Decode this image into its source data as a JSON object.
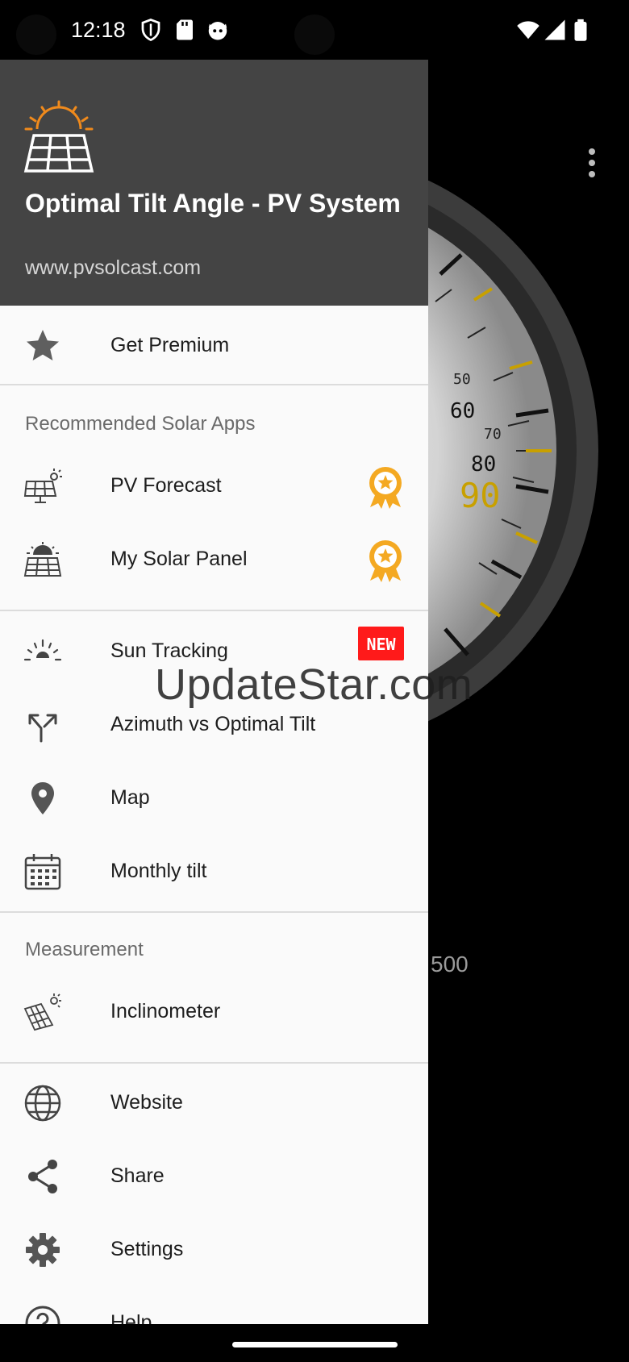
{
  "status_bar": {
    "time": "12:18",
    "left_icons": [
      "shield-icon",
      "sd-card-icon",
      "cat-icon"
    ],
    "right_icons": [
      "wifi-icon",
      "signal-icon",
      "battery-icon"
    ]
  },
  "background_app": {
    "gauge_labels": [
      "50",
      "60",
      "70",
      "80",
      "90"
    ],
    "partial_label": "500",
    "accent_color": "#c8a000"
  },
  "drawer": {
    "header": {
      "title": "Optimal Tilt Angle - PV System",
      "subtitle": "www.pvsolcast.com",
      "background_color": "#444444",
      "logo_icon": "solar-panel-sun-icon"
    },
    "premium": {
      "label": "Get Premium",
      "icon": "star-icon"
    },
    "recommended": {
      "title": "Recommended Solar Apps",
      "items": [
        {
          "label": "PV Forecast",
          "icon": "pv-forecast-icon",
          "badge": "award-ribbon-icon"
        },
        {
          "label": "My Solar Panel",
          "icon": "solar-panel-icon",
          "badge": "award-ribbon-icon"
        }
      ]
    },
    "tools": [
      {
        "label": "Sun Tracking",
        "icon": "sun-rays-icon",
        "badge_text": "NEW"
      },
      {
        "label": "Azimuth vs Optimal Tilt",
        "icon": "split-arrows-icon"
      },
      {
        "label": "Map",
        "icon": "map-pin-icon"
      },
      {
        "label": "Monthly tilt",
        "icon": "calendar-icon"
      }
    ],
    "measurement": {
      "title": "Measurement",
      "items": [
        {
          "label": "Inclinometer",
          "icon": "tilted-panel-icon"
        }
      ]
    },
    "more": [
      {
        "label": "Website",
        "icon": "globe-icon"
      },
      {
        "label": "Share",
        "icon": "share-icon"
      },
      {
        "label": "Settings",
        "icon": "gear-icon"
      },
      {
        "label": "Help",
        "icon": "help-icon"
      }
    ]
  },
  "watermark": "UpdateStar.com"
}
